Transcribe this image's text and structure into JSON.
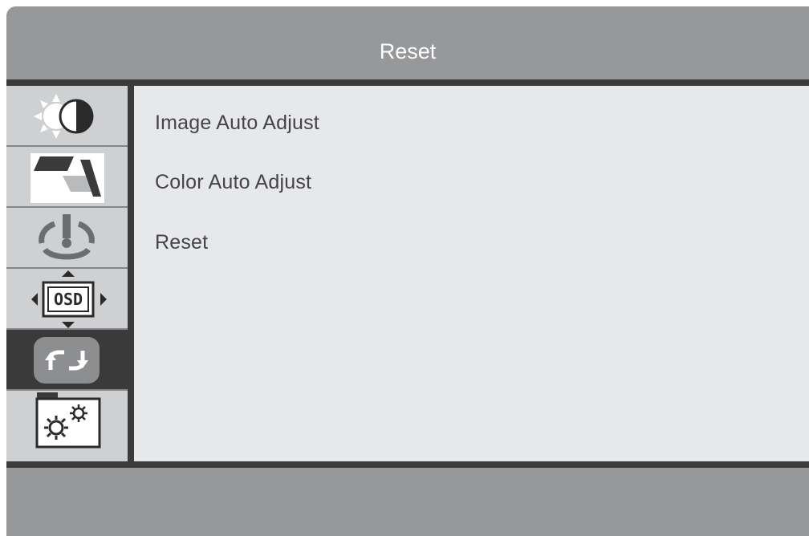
{
  "header": {
    "title": "Reset"
  },
  "sidebar": {
    "tabs": [
      {
        "icon": "brightness-contrast-icon",
        "selected": false
      },
      {
        "icon": "image-geometry-icon",
        "selected": false
      },
      {
        "icon": "color-icon",
        "selected": false
      },
      {
        "icon": "osd-position-icon",
        "selected": false
      },
      {
        "icon": "reset-arrows-icon",
        "selected": true
      },
      {
        "icon": "settings-gears-icon",
        "selected": false
      }
    ],
    "osd_icon_text": "OSD"
  },
  "menu": {
    "items": [
      {
        "label": "Image Auto Adjust"
      },
      {
        "label": "Color Auto Adjust"
      },
      {
        "label": "Reset"
      }
    ]
  },
  "colors": {
    "header": "#97989a",
    "divider": "#3b3b3c",
    "content": "#e7e8e9",
    "tab": "#cfd0d2",
    "tab_selected": "#3a3a3b",
    "text": "#444446",
    "title_text": "#ffffff"
  }
}
